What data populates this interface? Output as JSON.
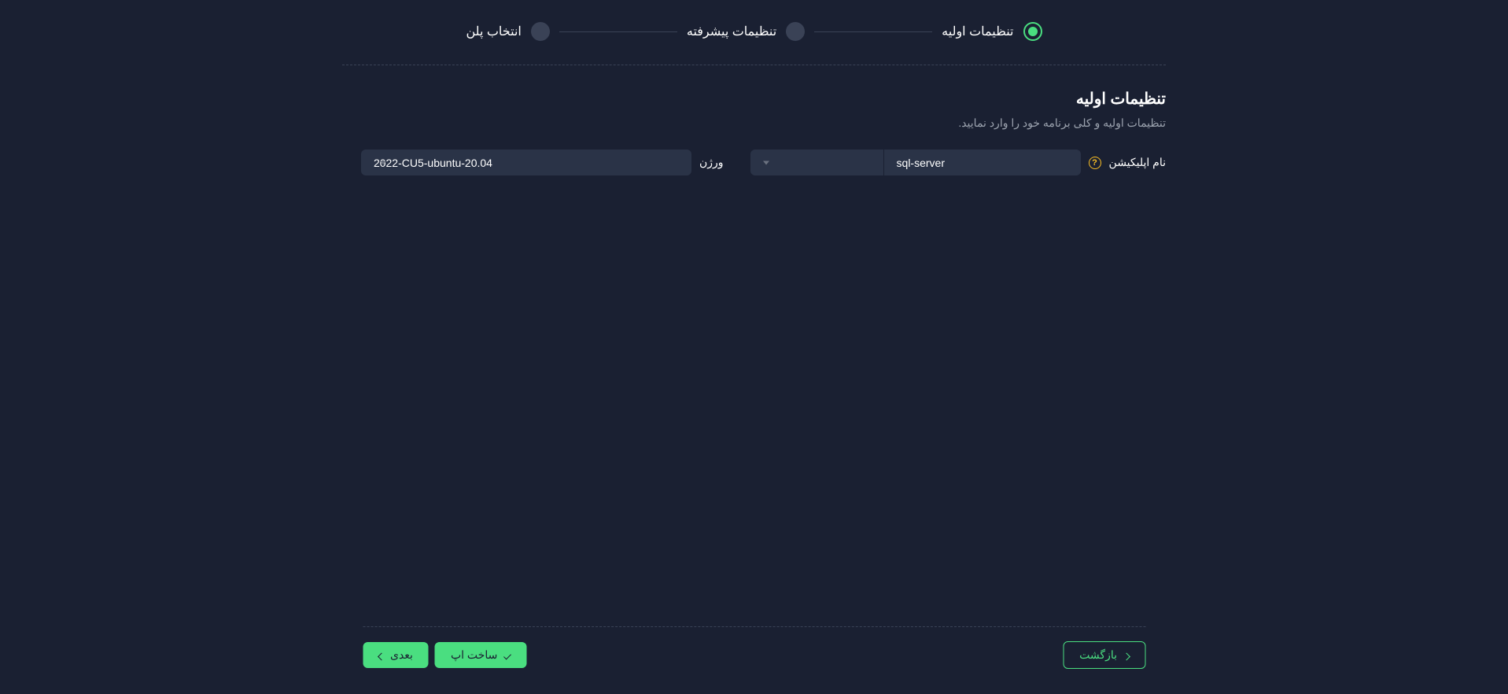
{
  "stepper": {
    "steps": [
      {
        "label": "تنظیمات اولیه",
        "active": true
      },
      {
        "label": "تنظیمات پیشرفته",
        "active": false
      },
      {
        "label": "انتخاب پلن",
        "active": false
      }
    ]
  },
  "section": {
    "title": "تنظیمات اولیه",
    "subtitle": "تنظیمات اولیه و کلی برنامه خود را وارد نمایید."
  },
  "form": {
    "appNameLabel": "نام اپلیکیشن",
    "appNameValue": "sql-server",
    "versionLabel": "ورژن",
    "versionValue": "2022-CU5-ubuntu-20.04"
  },
  "footer": {
    "backLabel": "بازگشت",
    "createLabel": "ساخت اپ",
    "nextLabel": "بعدی"
  }
}
